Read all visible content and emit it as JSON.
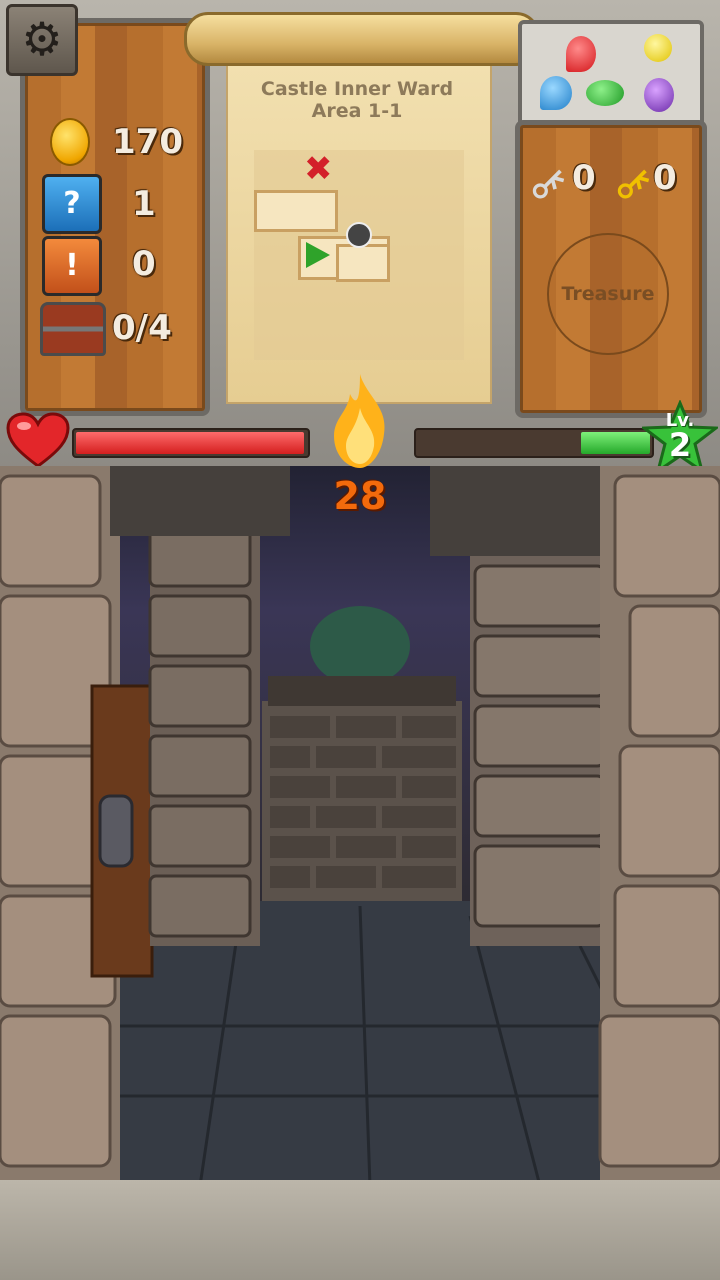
{
  "map": {
    "title_line1": "Castle Inner Ward",
    "title_line2": "Area 1-1"
  },
  "stats": {
    "coins": "170",
    "blue_boxes": "1",
    "orange_boxes": "0",
    "chests": "0/4"
  },
  "keys": {
    "silver_count": "0",
    "gold_count": "0"
  },
  "treasure_label": "Treasure",
  "player": {
    "hp_fraction": 0.99,
    "xp_fraction": 0.31,
    "level_prefix": "Lv.",
    "level": "2",
    "torch_count": "28"
  },
  "icons": {
    "settings": "gear-icon",
    "coin": "coin-icon",
    "blue_box": "blue-mystery-box-icon",
    "orange_box": "orange-mystery-box-icon",
    "chest": "treasure-chest-icon",
    "silver_key": "silver-key-icon",
    "gold_key": "gold-key-icon",
    "heart": "heart-icon",
    "star": "level-star-icon",
    "torch": "flame-icon"
  },
  "colors": {
    "hp": "#e52a2a",
    "xp": "#3cc43a",
    "torch_text": "#f36a0c",
    "wood": "#b66f2d"
  }
}
